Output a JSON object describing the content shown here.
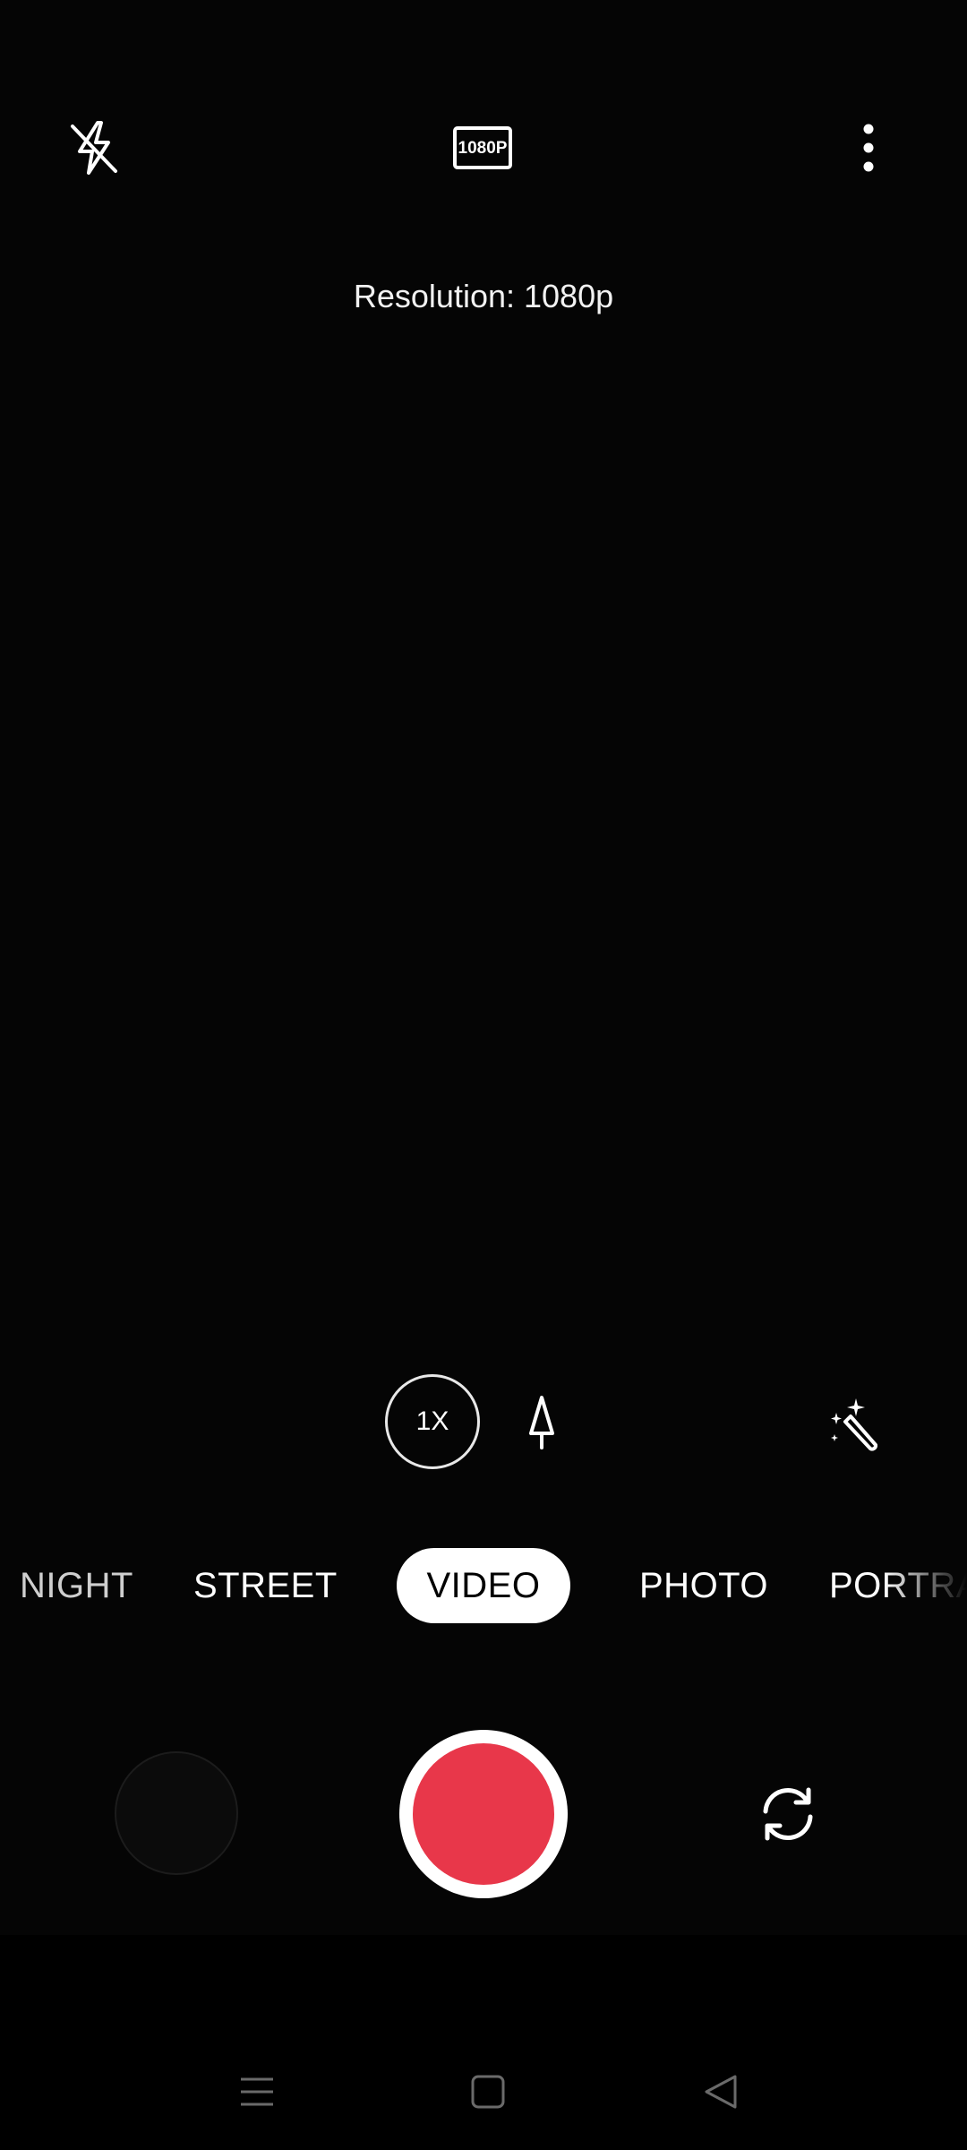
{
  "top_bar": {
    "flash_icon": "flash-off-icon",
    "resolution_badge": "1080P",
    "more_icon": "more-vertical-icon"
  },
  "toast": {
    "resolution_text": "Resolution: 1080p"
  },
  "controls": {
    "zoom_label": "1X",
    "tilt_icon": "tilt-shift-icon",
    "filter_icon": "magic-wand-icon"
  },
  "modes": {
    "items": [
      "NIGHT",
      "STREET",
      "VIDEO",
      "PHOTO",
      "PORTRAIT"
    ],
    "selected": "VIDEO"
  },
  "bottom": {
    "gallery_icon": "gallery-thumbnail",
    "record_color": "#e8374a",
    "switch_icon": "switch-camera-icon"
  },
  "navigation": {
    "menu_icon": "menu-icon",
    "home_icon": "home-icon",
    "back_icon": "back-icon"
  }
}
